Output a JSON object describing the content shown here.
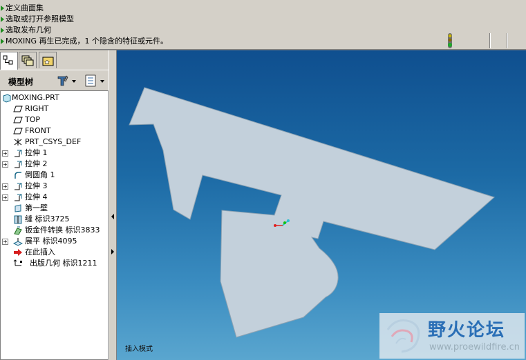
{
  "messages": [
    "定义曲面集",
    "选取或打开参照模型",
    "选取发布几何"
  ],
  "status_message": "MOXING 再生已完成，1 个隐含的特征或元件。",
  "left_panel": {
    "tabs": [
      "model-tree-tab",
      "layers-tab",
      "favorites-tab"
    ],
    "header_title": "模型树"
  },
  "tree": {
    "root": "MOXING.PRT",
    "items": [
      {
        "label": "RIGHT",
        "icon": "datum-plane-icon",
        "expandable": false
      },
      {
        "label": "TOP",
        "icon": "datum-plane-icon",
        "expandable": false
      },
      {
        "label": "FRONT",
        "icon": "datum-plane-icon",
        "expandable": false
      },
      {
        "label": "PRT_CSYS_DEF",
        "icon": "csys-icon",
        "expandable": false
      },
      {
        "label": "拉伸 1",
        "icon": "extrude-icon",
        "expandable": true
      },
      {
        "label": "拉伸 2",
        "icon": "extrude-icon",
        "expandable": true
      },
      {
        "label": "倒圆角 1",
        "icon": "round-icon",
        "expandable": false
      },
      {
        "label": "拉伸 3",
        "icon": "extrude-icon",
        "expandable": true
      },
      {
        "label": "拉伸 4",
        "icon": "extrude-icon",
        "expandable": true
      },
      {
        "label": "第一壁",
        "icon": "wall-icon",
        "expandable": false
      },
      {
        "label": "缝 标识3725",
        "icon": "rip-icon",
        "expandable": false
      },
      {
        "label": "钣金件转换 标识3833",
        "icon": "convert-icon",
        "expandable": false
      },
      {
        "label": "展平 标识4095",
        "icon": "flat-icon",
        "expandable": true
      },
      {
        "label": "在此插入",
        "icon": "insert-here-arrow-icon",
        "expandable": false
      },
      {
        "label": "出版几何 标识1211",
        "icon": "publish-geom-icon",
        "expandable": false
      }
    ]
  },
  "viewport": {
    "mode_text": "插入模式",
    "watermark_title": "野火论坛",
    "watermark_url": "www.proewildfire.cn",
    "part_color": "#c3d0db"
  }
}
